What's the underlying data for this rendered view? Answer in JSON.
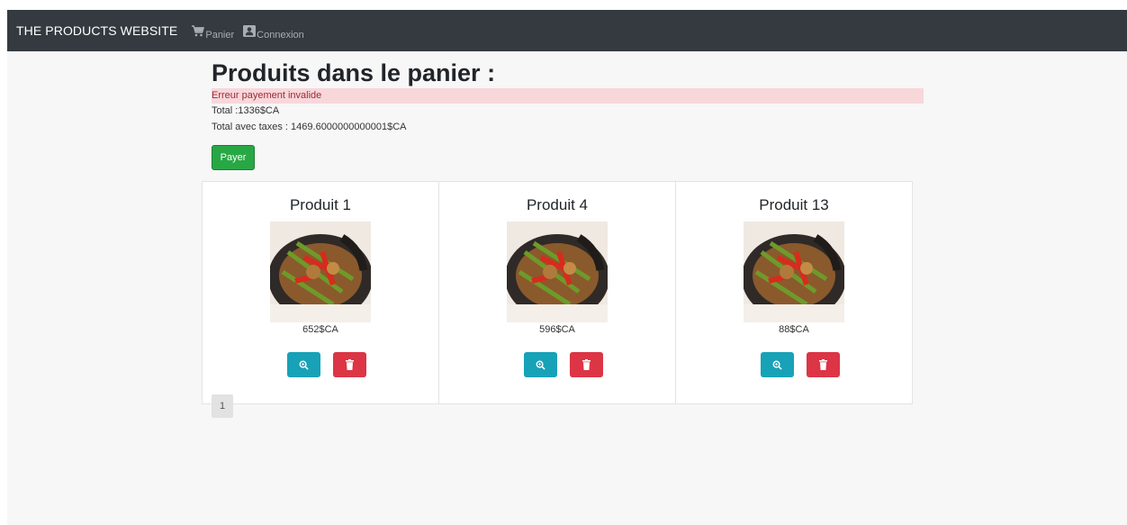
{
  "navbar": {
    "brand": "THE PRODUCTS WEBSITE",
    "links": [
      {
        "label": "Panier",
        "icon": "cart-icon"
      },
      {
        "label": "Connexion",
        "icon": "contact-card-icon"
      }
    ]
  },
  "main": {
    "title": "Produits dans le panier :",
    "alert": "Erreur payement invalide",
    "total": "Total :1336$CA",
    "total_taxes": "Total avec taxes : 1469.6000000000001$CA",
    "pay_label": "Payer"
  },
  "products": [
    {
      "name": "Produit 1",
      "price": "652$CA"
    },
    {
      "name": "Produit 4",
      "price": "596$CA"
    },
    {
      "name": "Produit 13",
      "price": "88$CA"
    }
  ],
  "pagination": {
    "current": "1"
  },
  "colors": {
    "navbar": "#343a40",
    "success": "#28a745",
    "info": "#17a2b8",
    "danger": "#dc3545",
    "alert_bg": "#f8d7da"
  }
}
